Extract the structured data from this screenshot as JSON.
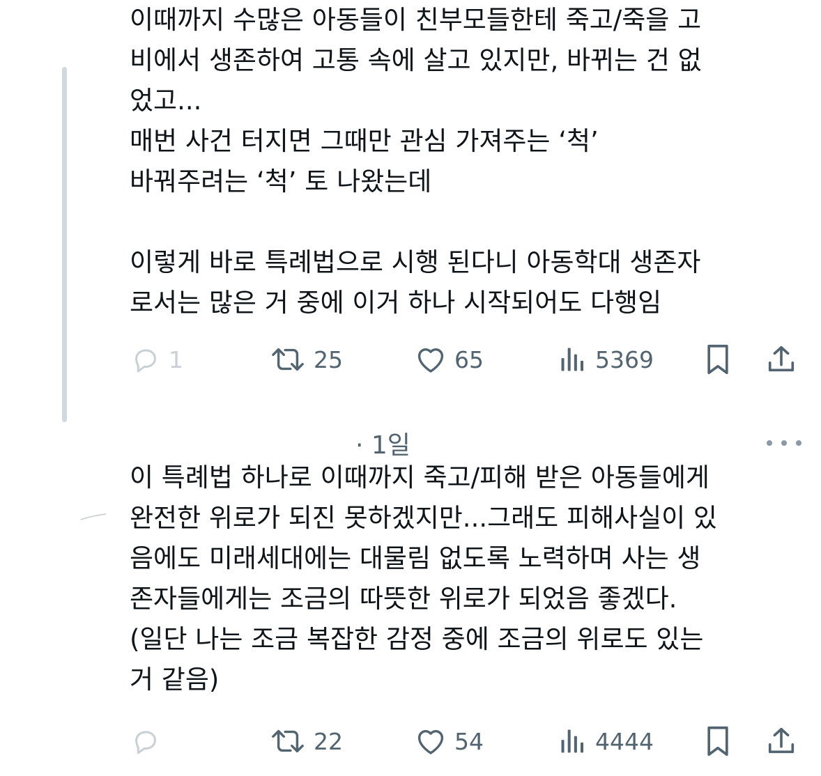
{
  "tweets": [
    {
      "text": "이때까지 수많은 아동들이 친부모들한테 죽고/죽을 고\n비에서 생존하여 고통 속에 살고 있지만, 바뀌는 건 없\n었고...\n매번 사건 터지면 그때만 관심 가져주는 ‘척’\n바꿔주려는 ‘척’ 토 나왔는데\n\n이렇게 바로 특례법으로 시행 된다니 아동학대 생존자\n로서는 많은 거 중에 이거 하나 시작되어도 다행임",
      "actions": {
        "replies": "1",
        "reposts": "25",
        "likes": "65",
        "views": "5369"
      }
    },
    {
      "timestamp": "· 1일",
      "text": "이 특례법 하나로 이때까지 죽고/피해 받은 아동들에게\n완전한 위로가 되진 못하겠지만...그래도 피해사실이 있\n음에도 미래세대에는 대물림 없도록 노력하며 사는 생\n존자들에게는 조금의 따뜻한 위로가 되었음 좋겠다.\n(일단 나는 조금 복잡한 감정 중에 조금의 위로도 있는\n거 같음)",
      "actions": {
        "reposts": "22",
        "likes": "54",
        "views": "4444"
      }
    }
  ],
  "icons": {
    "reply": "reply-icon",
    "repost": "repost-icon",
    "like": "heart-icon",
    "views": "views-chart-icon",
    "bookmark": "bookmark-icon",
    "share": "share-icon",
    "more": "more-dots-icon"
  },
  "colors": {
    "text": "#0f1419",
    "secondary": "#536471",
    "thread_line": "#cfd9de"
  }
}
